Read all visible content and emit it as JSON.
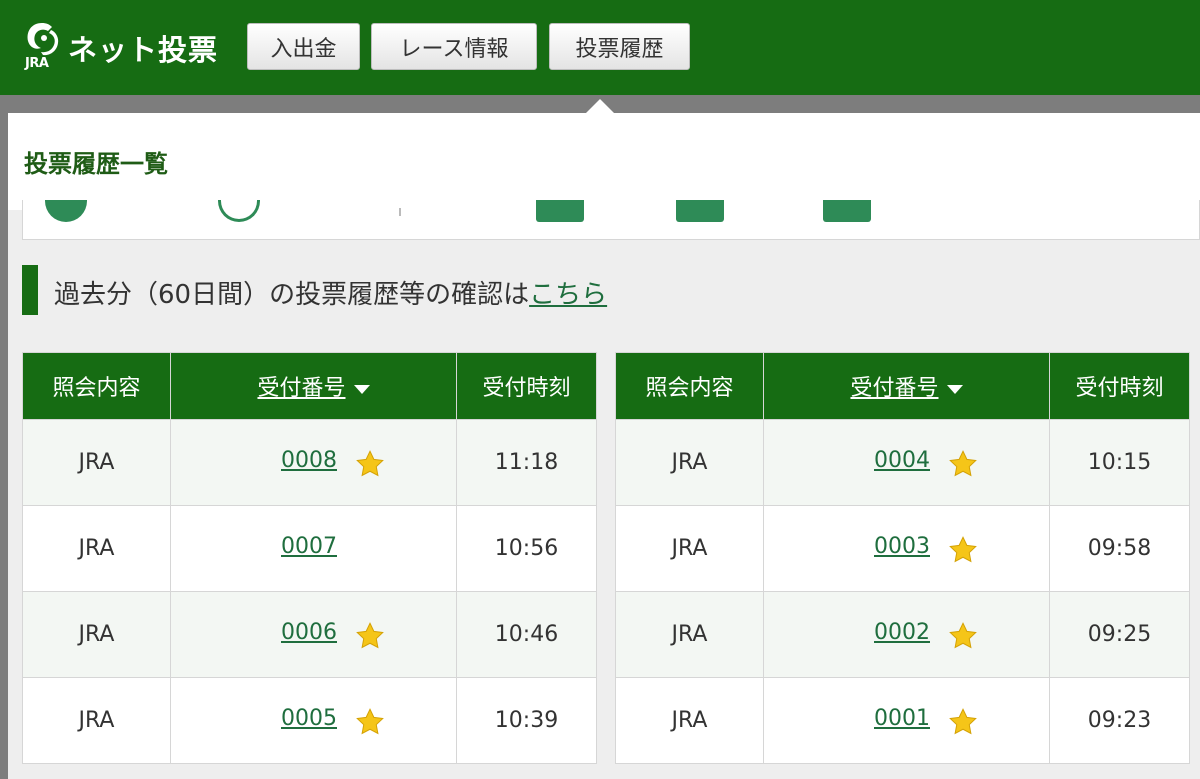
{
  "header": {
    "logo_text": "ネット投票",
    "logo_sub": "JRA",
    "nav": [
      "入出金",
      "レース情報",
      "投票履歴"
    ]
  },
  "popup": {
    "title": "投票履歴一覧"
  },
  "history_link": {
    "prefix": "過去分（60日間）の投票履歴等の確認は",
    "link": "こちら"
  },
  "table_headers": {
    "col1": "照会内容",
    "col2": "受付番号",
    "col3": "受付時刻"
  },
  "tables": [
    {
      "rows": [
        {
          "type": "JRA",
          "number": "0008",
          "favorite": true,
          "time": "11:18"
        },
        {
          "type": "JRA",
          "number": "0007",
          "favorite": false,
          "time": "10:56"
        },
        {
          "type": "JRA",
          "number": "0006",
          "favorite": true,
          "time": "10:46"
        },
        {
          "type": "JRA",
          "number": "0005",
          "favorite": true,
          "time": "10:39"
        }
      ]
    },
    {
      "rows": [
        {
          "type": "JRA",
          "number": "0004",
          "favorite": true,
          "time": "10:15"
        },
        {
          "type": "JRA",
          "number": "0003",
          "favorite": true,
          "time": "09:58"
        },
        {
          "type": "JRA",
          "number": "0002",
          "favorite": true,
          "time": "09:25"
        },
        {
          "type": "JRA",
          "number": "0001",
          "favorite": true,
          "time": "09:23"
        }
      ]
    }
  ],
  "colors": {
    "brand_green": "#166c13",
    "link_green": "#1f6e3e",
    "star": "#f5c518"
  },
  "icons": {
    "favorite": "star-icon",
    "sort": "sort-down-icon"
  }
}
